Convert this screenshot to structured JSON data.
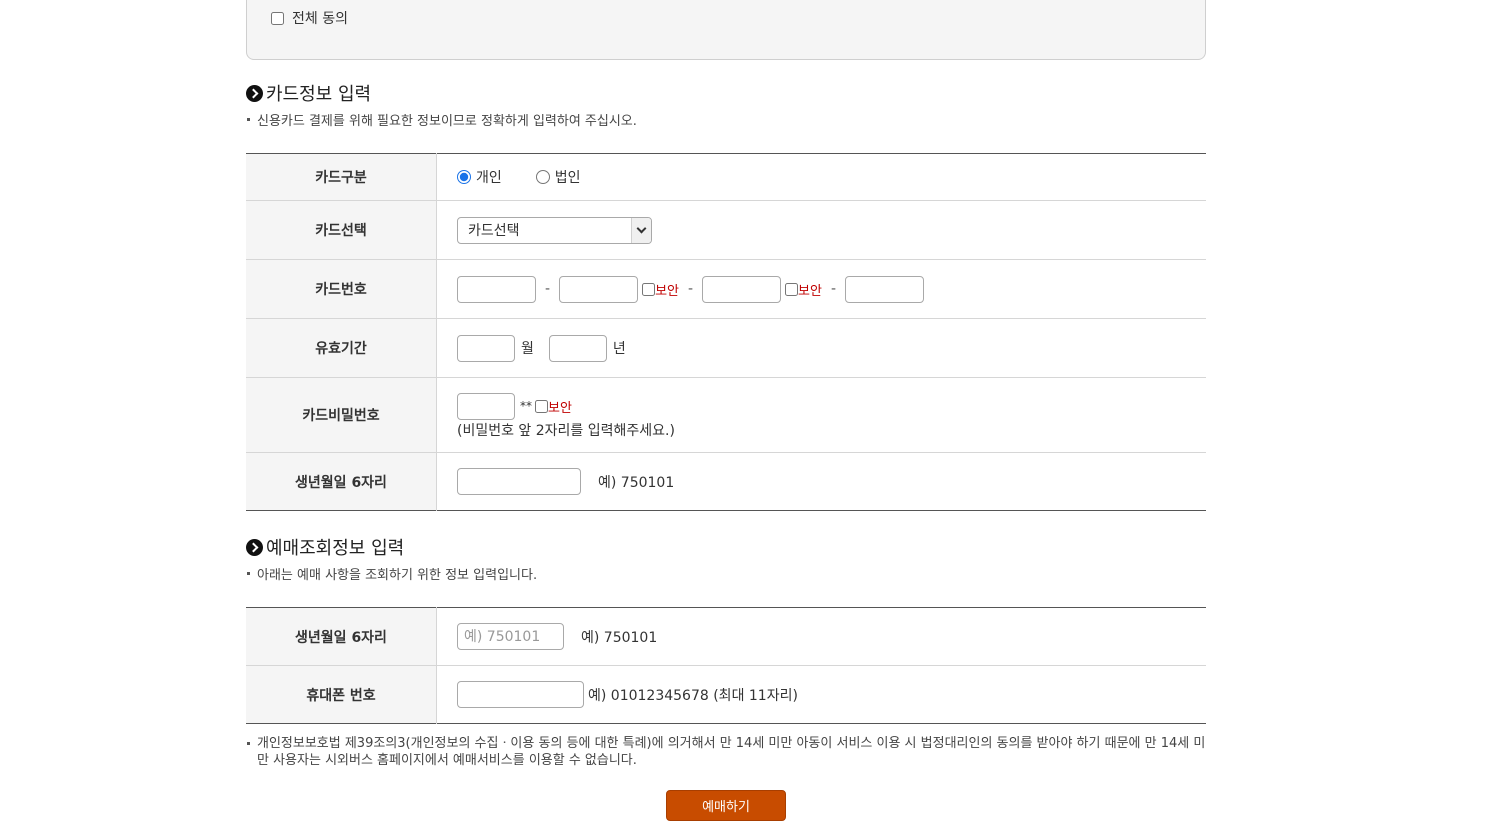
{
  "agree": {
    "all_label": "전체 동의"
  },
  "card_section": {
    "title": "카드정보 입력",
    "desc": "신용카드 결제를 위해 필요한 정보이므로 정확하게 입력하여 주십시오.",
    "rows": {
      "card_type": {
        "label": "카드구분",
        "options": [
          "개인",
          "법인"
        ],
        "selected": "개인"
      },
      "card_select": {
        "label": "카드선택",
        "value": "카드선택"
      },
      "card_number": {
        "label": "카드번호",
        "security": "보안",
        "dash": "-"
      },
      "expiry": {
        "label": "유효기간",
        "month_unit": "월",
        "year_unit": "년"
      },
      "card_pw": {
        "label": "카드비밀번호",
        "mask": "**",
        "security": "보안",
        "hint": "(비밀번호 앞 2자리를 입력해주세요.)"
      },
      "birth": {
        "label": "생년월일 6자리",
        "example": "예) 750101"
      }
    }
  },
  "reserve_section": {
    "title": "예매조회정보 입력",
    "desc": "아래는 예매 사항을 조회하기 위한 정보 입력입니다.",
    "rows": {
      "birth": {
        "label": "생년월일 6자리",
        "placeholder": "예) 750101",
        "example": "예) 750101"
      },
      "phone": {
        "label": "휴대폰 번호",
        "example": "예) 01012345678 (최대 11자리)"
      }
    }
  },
  "notice": "개인정보보호법 제39조의3(개인정보의 수집ㆍ이용 동의 등에 대한 특례)에 의거해서 만 14세 미만 아동이 서비스 이용 시 법정대리인의 동의를 받아야 하기 때문에 만 14세 미만 사용자는 시외버스 홈페이지에서 예매서비스를 이용할 수 없습니다.",
  "submit_label": "예매하기",
  "colors": {
    "button": "#c84c00",
    "security_red": "#c00000"
  }
}
